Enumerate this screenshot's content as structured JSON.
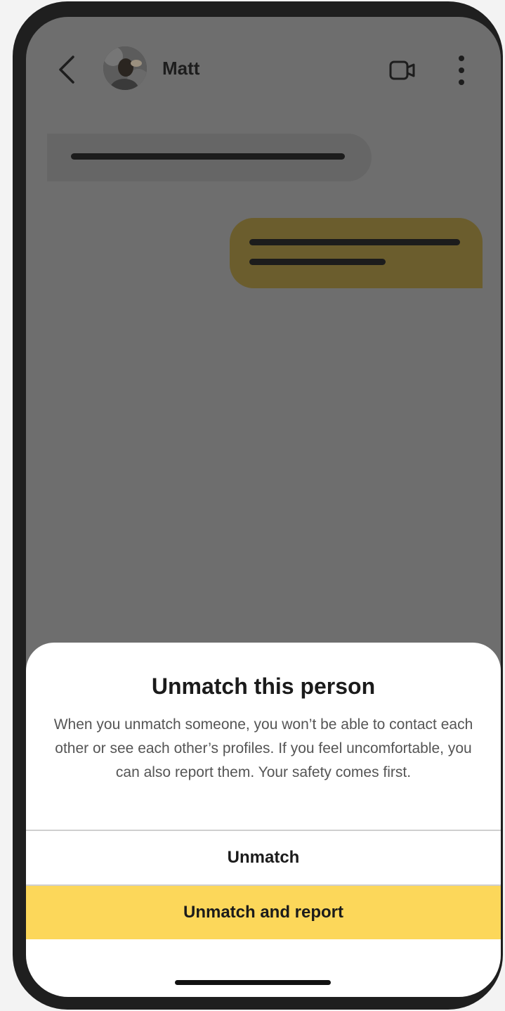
{
  "header": {
    "contact_name": "Matt",
    "icons": {
      "back": "chevron-left-icon",
      "video": "video-call-icon",
      "more": "more-vertical-icon"
    }
  },
  "colors": {
    "overlay": "#6e6e6e",
    "outgoing_bubble": "#6b5d2d",
    "accent": "#fcd75a",
    "sheet_background": "#ffffff"
  },
  "sheet": {
    "title": "Unmatch this person",
    "description": "When you unmatch someone, you won’t be able to contact each other or see each other’s profiles. If you feel uncomfortable, you can also report them. Your safety comes first.",
    "unmatch_label": "Unmatch",
    "unmatch_report_label": "Unmatch and report"
  }
}
